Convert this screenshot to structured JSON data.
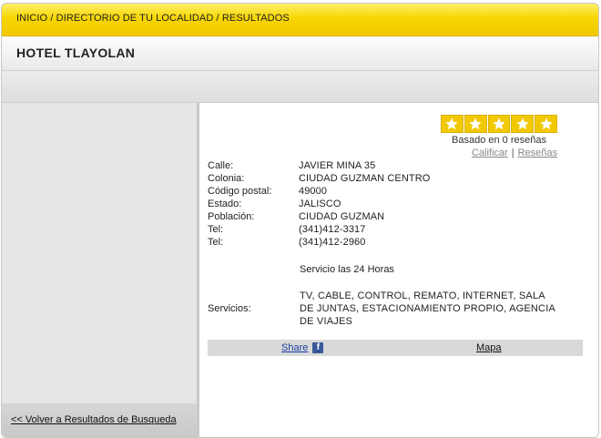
{
  "breadcrumb": "INICIO / DIRECTORIO DE TU LOCALIDAD / RESULTADOS",
  "page_title": "HOTEL TLAYOLAN",
  "sidebar": {
    "back_label": "<< Volver a Resultados de Busqueda"
  },
  "rating": {
    "stars_filled": 5,
    "stars_total": 5,
    "based_on": "Basado en 0 reseñas",
    "rate_label": "Calificar",
    "separator": "|",
    "reviews_label": "Reseñas"
  },
  "info": [
    {
      "label": "Calle:",
      "value": "JAVIER MINA 35"
    },
    {
      "label": "Colonia:",
      "value": "CIUDAD GUZMAN CENTRO"
    },
    {
      "label": "Código postal:",
      "value": "49000"
    },
    {
      "label": "Estado:",
      "value": "JALISCO"
    },
    {
      "label": "Población:",
      "value": "CIUDAD GUZMAN"
    },
    {
      "label": "Tel:",
      "value": "(341)412-3317"
    },
    {
      "label": "Tel:",
      "value": "(341)412-2960"
    }
  ],
  "service_note": "Servicio las 24 Horas",
  "services": {
    "label": "Servicios:",
    "value": "TV, CABLE, CONTROL, REMATO, INTERNET, SALA DE JUNTAS, ESTACIONAMIENTO PROPIO, AGENCIA DE VIAJES"
  },
  "actions": {
    "share_label": "Share",
    "fb_glyph": "f",
    "map_label": "Mapa"
  },
  "colors": {
    "header_yellow": "#f7d600",
    "star_yellow": "#f2c800",
    "facebook_blue": "#3b5998",
    "link_blue": "#1a3fa3"
  }
}
